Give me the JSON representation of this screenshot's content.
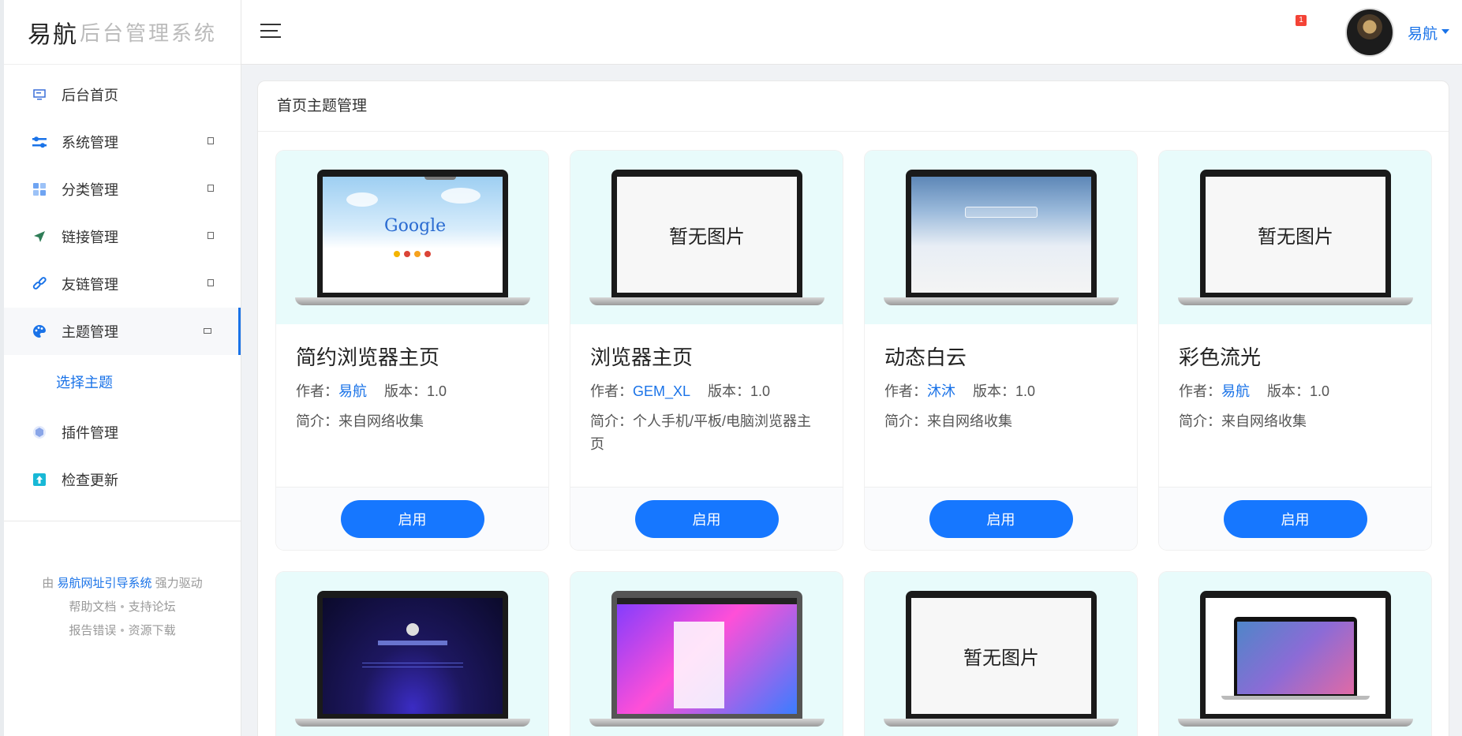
{
  "sidebar": {
    "logo_main": "易航",
    "logo_sub": "后台管理系统",
    "items": [
      {
        "label": "后台首页"
      },
      {
        "label": "系统管理"
      },
      {
        "label": "分类管理"
      },
      {
        "label": "链接管理"
      },
      {
        "label": "友链管理"
      },
      {
        "label": "主题管理"
      },
      {
        "label": "插件管理"
      },
      {
        "label": "检查更新"
      }
    ],
    "submenu": {
      "label": "选择主题"
    },
    "footer": {
      "prefix": "由",
      "brand": "易航网址引导系统",
      "suffix": "强力驱动",
      "help": "帮助文档",
      "forum": "支持论坛",
      "report": "报告错误",
      "download": "资源下载"
    }
  },
  "header": {
    "notification_count": "1",
    "user_name": "易航"
  },
  "panel": {
    "title": "首页主题管理",
    "no_image": "暂无图片",
    "author_label": "作者：",
    "version_label": "版本：",
    "desc_label": "简介：",
    "themes": [
      {
        "title": "简约浏览器主页",
        "author": "易航",
        "version": "1.0",
        "desc": "来自网络收集",
        "button": "启用"
      },
      {
        "title": "浏览器主页",
        "author": "GEM_XL",
        "version": "1.0",
        "desc": "个人手机/平板/电脑浏览器主页",
        "button": "启用"
      },
      {
        "title": "动态白云",
        "author": "沐沐",
        "version": "1.0",
        "desc": "来自网络收集",
        "button": "启用"
      },
      {
        "title": "彩色流光",
        "author": "易航",
        "version": "1.0",
        "desc": "来自网络收集",
        "button": "启用"
      }
    ]
  },
  "colors": {
    "accent": "#1677ff",
    "thumb_bg": "#e8fbfb"
  }
}
